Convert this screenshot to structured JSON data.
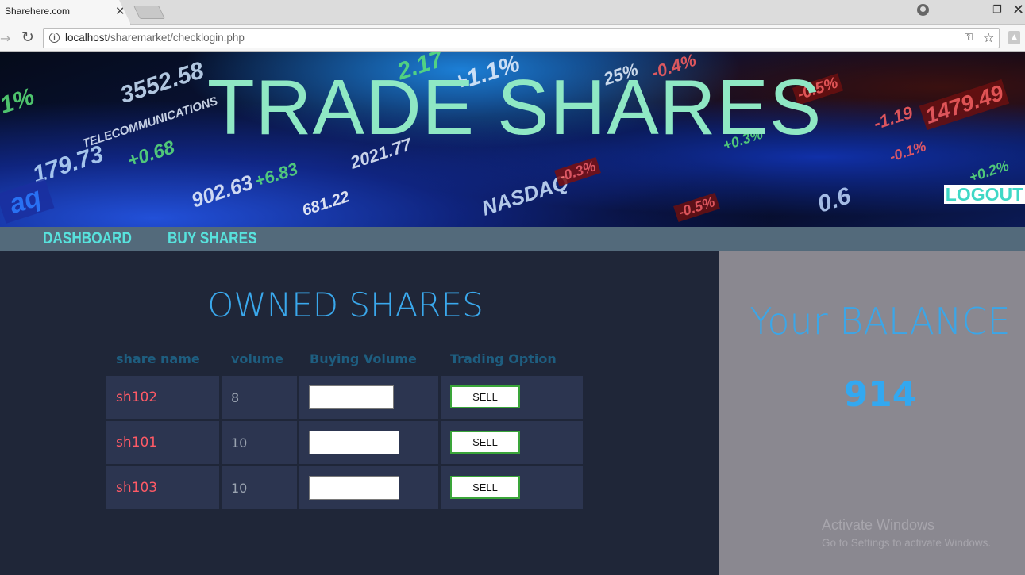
{
  "browser": {
    "tab_title": "Sharehere.com",
    "tab_close": "✕",
    "url_host": "localhost",
    "url_path": "/sharemarket/checklogin.php",
    "minimize": "—",
    "restore": "❐"
  },
  "banner": {
    "title": "TRADE SHARES",
    "logout_label": "LOGOUT"
  },
  "nav": {
    "items": [
      {
        "label": "DASHBOARD"
      },
      {
        "label": "BUY SHARES"
      }
    ]
  },
  "owned": {
    "title": "OWNED SHARES",
    "headers": [
      "share name",
      "volume",
      "Buying Volume",
      "Trading Option"
    ],
    "rows": [
      {
        "share_name": "sh102",
        "volume": "8",
        "buying_volume": "",
        "action": "SELL"
      },
      {
        "share_name": "sh101",
        "volume": "10",
        "buying_volume": "",
        "action": "SELL"
      },
      {
        "share_name": "sh103",
        "volume": "10",
        "buying_volume": "",
        "action": "SELL"
      }
    ]
  },
  "balance": {
    "title": "Your BALANCE",
    "value": "914"
  },
  "watermark": {
    "title": "Activate Windows",
    "subtitle": "Go to Settings to activate Windows."
  },
  "colors": {
    "banner_title": "#8fe8c4",
    "nav_link": "#58e2dd",
    "accent_blue": "#3aa8ec",
    "share_name": "#ff5a66",
    "sell_border": "#3aa53a"
  }
}
